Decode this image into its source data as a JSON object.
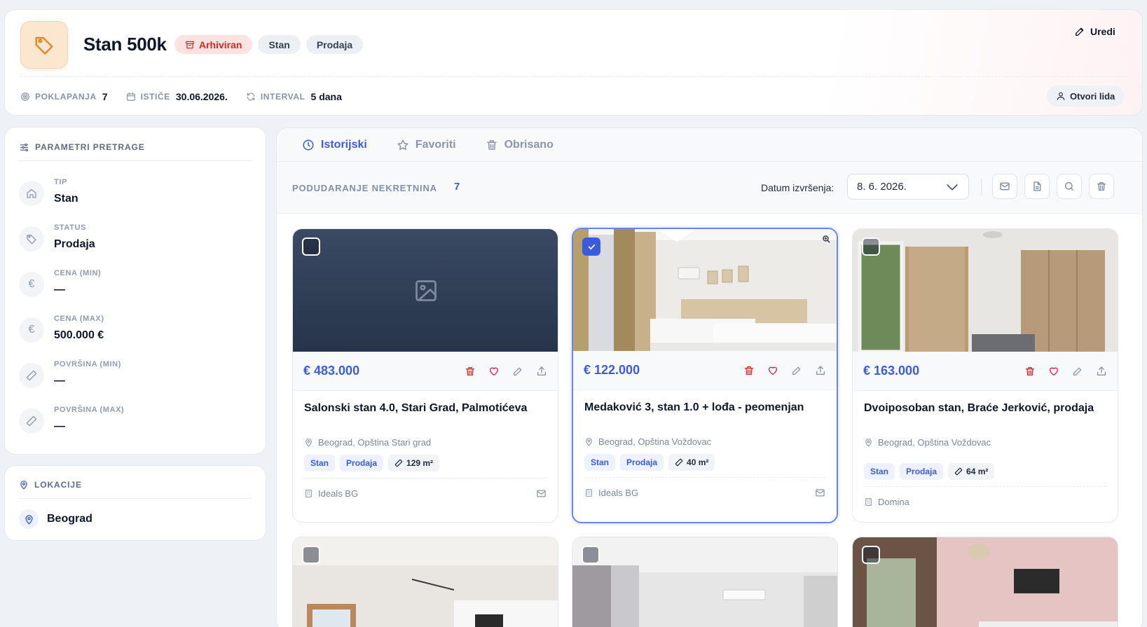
{
  "header": {
    "title": "Stan 500k",
    "badges": [
      "Arhiviran",
      "Stan",
      "Prodaja"
    ],
    "edit_label": "Uredi",
    "open_lead_label": "Otvori lida",
    "stats": [
      {
        "label": "POKLAPANJA",
        "value": "7"
      },
      {
        "label": "ISTIČE",
        "value": "30.06.2026."
      },
      {
        "label": "INTERVAL",
        "value": "5 dana"
      }
    ]
  },
  "params": {
    "title": "PARAMETRI PRETRAGE",
    "items": [
      {
        "label": "TIP",
        "value": "Stan",
        "icon": "home-icon"
      },
      {
        "label": "STATUS",
        "value": "Prodaja",
        "icon": "tag-icon"
      },
      {
        "label": "CENA (MIN)",
        "value": "—",
        "icon": "euro-icon"
      },
      {
        "label": "CENA (MAX)",
        "value": "500.000 €",
        "icon": "euro-icon"
      },
      {
        "label": "POVRŠINA (MIN)",
        "value": "—",
        "icon": "ruler-icon"
      },
      {
        "label": "POVRŠINA (MAX)",
        "value": "—",
        "icon": "ruler-icon"
      }
    ]
  },
  "locations": {
    "title": "LOKACIJE",
    "items": [
      "Beograd"
    ]
  },
  "tabs": [
    {
      "label": "Istorijski",
      "active": true
    },
    {
      "label": "Favoriti",
      "active": false
    },
    {
      "label": "Obrisano",
      "active": false
    }
  ],
  "toolbar": {
    "match_label": "PODUDARANJE NEKRETNINA",
    "match_count": "7",
    "date_label": "Datum izvršenja:",
    "date_value": "8. 6. 2026."
  },
  "cards": [
    {
      "price": "€ 483.000",
      "title": "Salonski stan 4.0, Stari Grad, Palmotićeva",
      "location": "Beograd, Opština Stari grad",
      "tags": [
        "Stan",
        "Prodaja"
      ],
      "area": "129 m²",
      "agency": "Ideals BG",
      "selected": false
    },
    {
      "price": "€ 122.000",
      "title": "Medaković 3, stan 1.0 + lođa - peomenjan",
      "location": "Beograd, Opština Voždovac",
      "tags": [
        "Stan",
        "Prodaja"
      ],
      "area": "40 m²",
      "agency": "Ideals BG",
      "selected": true
    },
    {
      "price": "€ 163.000",
      "title": "Dvoiposoban stan, Braće Jerković, prodaja",
      "location": "Beograd, Opština Voždovac",
      "tags": [
        "Stan",
        "Prodaja"
      ],
      "area": "64 m²",
      "agency": "Domina",
      "selected": false
    }
  ],
  "colors": {
    "accent": "#3b5bdb",
    "danger": "#dc2626",
    "archived_bg": "#fde2e2",
    "avatar_bg": "#fbe7cf",
    "avatar_icon": "#e08a2c"
  }
}
